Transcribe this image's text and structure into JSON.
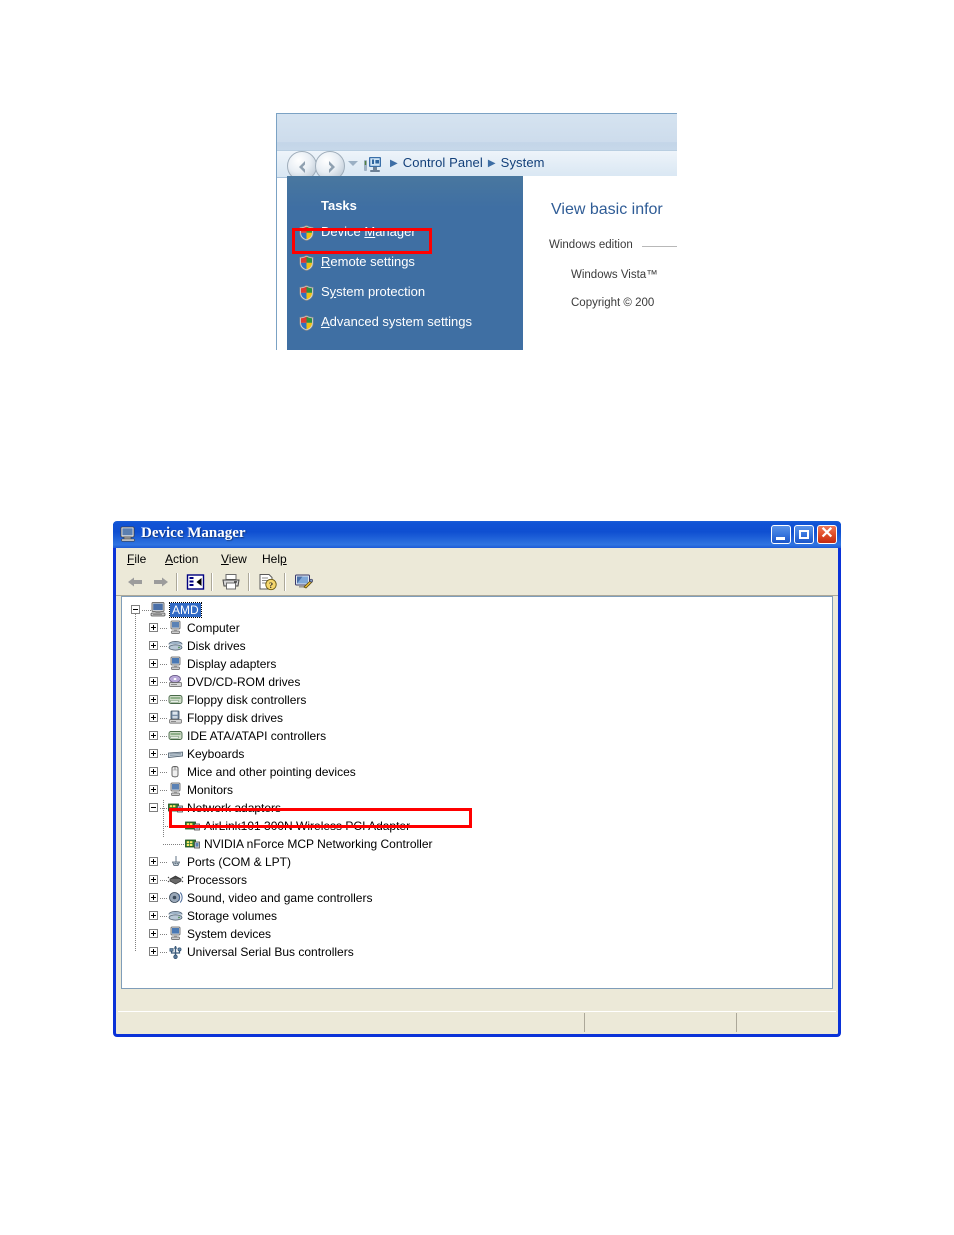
{
  "vista_panel": {
    "window_name": "System Control Panel",
    "nav": {
      "back_icon": "back-arrow-icon",
      "forward_icon": "forward-arrow-icon",
      "history_dropdown_icon": "chevron-down-icon",
      "breadcrumb_root_icon": "computer-icon"
    },
    "breadcrumbs": [
      {
        "label": "Control Panel"
      },
      {
        "label": "System"
      }
    ],
    "separator": "▶",
    "sidebar": {
      "header": "Tasks",
      "items": [
        {
          "label_before": "Device ",
          "accel": "M",
          "label_after": "anager",
          "icon": "shield-icon",
          "highlighted": true
        },
        {
          "label_before": "",
          "accel": "R",
          "label_after": "emote settings",
          "icon": "shield-icon",
          "highlighted": false
        },
        {
          "label_before": "S",
          "accel": "y",
          "label_after": "stem protection",
          "icon": "shield-icon",
          "highlighted": false
        },
        {
          "label_before": "",
          "accel": "A",
          "label_after": "dvanced system settings",
          "icon": "shield-icon",
          "highlighted": false
        }
      ]
    },
    "content": {
      "heading": "View basic infor",
      "section_label": "Windows edition",
      "line_1": "Windows Vista™",
      "line_2": "Copyright © 200"
    },
    "highlight_color": "#ff0000"
  },
  "device_manager": {
    "title": "Device Manager",
    "title_icon": "computer-icon",
    "window_buttons": {
      "minimize": "minimize-button",
      "maximize": "maximize-button",
      "close": "close-button",
      "close_glyph": "✕"
    },
    "menus": [
      {
        "accel": "F",
        "rest": "ile"
      },
      {
        "accel": "A",
        "rest": "ction"
      },
      {
        "accel": "V",
        "rest": "iew"
      },
      {
        "accel": "H",
        "rest": "elp",
        "accel_pos": "after",
        "pre": "Hel",
        "post": "p"
      }
    ],
    "toolbar": [
      {
        "name": "back-arrow-icon"
      },
      {
        "name": "forward-arrow-icon"
      },
      {
        "name": "separator"
      },
      {
        "name": "show-hide-console-tree-icon"
      },
      {
        "name": "separator"
      },
      {
        "name": "print-icon"
      },
      {
        "name": "separator"
      },
      {
        "name": "properties-help-icon"
      },
      {
        "name": "separator"
      },
      {
        "name": "scan-for-hardware-changes-icon"
      }
    ],
    "tree": {
      "root": {
        "label": "AMD",
        "icon": "computer-icon",
        "expanded": true,
        "selected": true
      },
      "nodes": [
        {
          "label": "Computer",
          "icon": "computer-device-icon",
          "state": "collapsed",
          "level": 1
        },
        {
          "label": "Disk drives",
          "icon": "disk-drive-icon",
          "state": "collapsed",
          "level": 1
        },
        {
          "label": "Display adapters",
          "icon": "display-adapter-icon",
          "state": "collapsed",
          "level": 1
        },
        {
          "label": "DVD/CD-ROM drives",
          "icon": "dvd-drive-icon",
          "state": "collapsed",
          "level": 1
        },
        {
          "label": "Floppy disk controllers",
          "icon": "controller-icon",
          "state": "collapsed",
          "level": 1
        },
        {
          "label": "Floppy disk drives",
          "icon": "floppy-drive-icon",
          "state": "collapsed",
          "level": 1
        },
        {
          "label": "IDE ATA/ATAPI controllers",
          "icon": "controller-icon",
          "state": "collapsed",
          "level": 1
        },
        {
          "label": "Keyboards",
          "icon": "keyboard-icon",
          "state": "collapsed",
          "level": 1
        },
        {
          "label": "Mice and other pointing devices",
          "icon": "mouse-icon",
          "state": "collapsed",
          "level": 1
        },
        {
          "label": "Monitors",
          "icon": "monitor-icon",
          "state": "collapsed",
          "level": 1
        },
        {
          "label": "Network adapters",
          "icon": "network-adapter-icon",
          "state": "expanded",
          "level": 1
        },
        {
          "label": "AirLink101 300N Wireless PCI Adapter",
          "icon": "network-adapter-icon",
          "state": "leaf",
          "level": 2,
          "highlighted": true
        },
        {
          "label": "NVIDIA nForce MCP Networking Controller",
          "icon": "network-adapter-icon",
          "state": "leaf",
          "level": 2
        },
        {
          "label": "Ports (COM & LPT)",
          "icon": "port-icon",
          "state": "collapsed",
          "level": 1
        },
        {
          "label": "Processors",
          "icon": "processor-icon",
          "state": "collapsed",
          "level": 1
        },
        {
          "label": "Sound, video and game controllers",
          "icon": "sound-icon",
          "state": "collapsed",
          "level": 1
        },
        {
          "label": "Storage volumes",
          "icon": "disk-drive-icon",
          "state": "collapsed",
          "level": 1
        },
        {
          "label": "System devices",
          "icon": "display-adapter-icon",
          "state": "collapsed",
          "level": 1
        },
        {
          "label": "Universal Serial Bus controllers",
          "icon": "usb-icon",
          "state": "collapsed",
          "level": 1
        }
      ]
    },
    "status_bar": {
      "pane_0": "",
      "pane_1": "",
      "pane_2": ""
    },
    "highlight_color": "#ff0000",
    "selection_color": "#316ac5",
    "titlebar_color": "#0f4fd1"
  }
}
